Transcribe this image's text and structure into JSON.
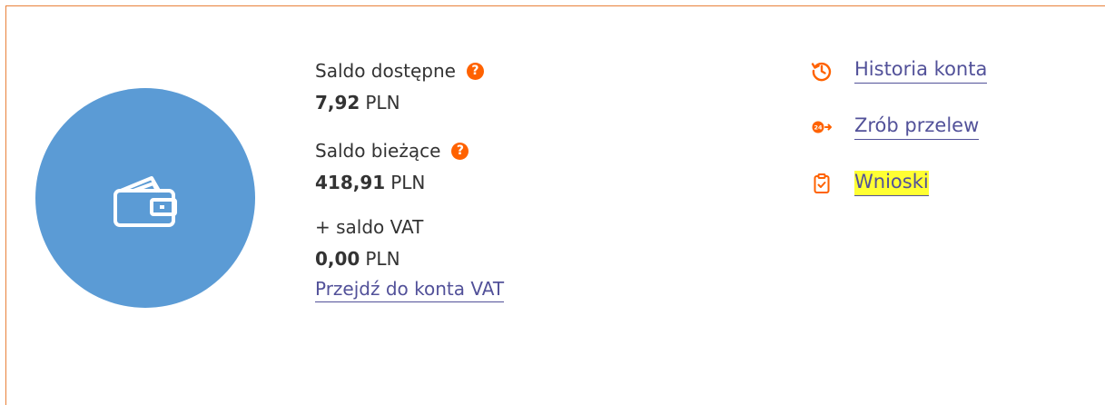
{
  "wallet": {
    "icon": "wallet-icon",
    "circle_color": "#5b9bd5"
  },
  "balances": {
    "available": {
      "label": "Saldo dostępne",
      "amount": "7,92",
      "currency": "PLN"
    },
    "current": {
      "label": "Saldo bieżące",
      "amount": "418,91",
      "currency": "PLN"
    },
    "vat": {
      "label": "+ saldo VAT",
      "amount": "0,00",
      "currency": "PLN",
      "link": "Przejdź do konta VAT"
    },
    "help_glyph": "?"
  },
  "actions": [
    {
      "icon": "history-icon",
      "label": "Historia konta",
      "highlighted": false
    },
    {
      "icon": "transfer-24-icon",
      "label": "Zrób przelew",
      "highlighted": false
    },
    {
      "icon": "clipboard-check-icon",
      "label": "Wnioski",
      "highlighted": true
    }
  ],
  "colors": {
    "accent": "#ff6200",
    "link": "#525199",
    "frame": "#e8813a",
    "highlight": "#ffff33"
  }
}
